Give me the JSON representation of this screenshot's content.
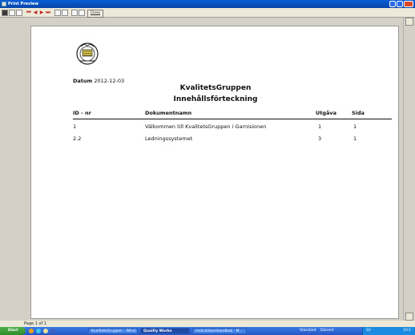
{
  "window": {
    "title": "Print Preview"
  },
  "toolbar": {
    "close_label": "Close"
  },
  "report": {
    "date_label": "Datum",
    "date_value": "2012-12-03",
    "company": "KvalitetsGruppen",
    "subtitle": "Innehållsförteckning",
    "columns": [
      "ID - nr",
      "Dokumentnamn",
      "Utgåva",
      "Sida"
    ],
    "rows": [
      [
        "1",
        "Välkommen till KvalitetsGruppen i Garnisionen",
        "1",
        "1"
      ],
      [
        "2.2",
        "Ledningssystemet",
        "3",
        "1"
      ]
    ]
  },
  "status": {
    "page": "Page 1 of 1"
  },
  "taskbar": {
    "start": "Start",
    "tasks": [
      "KvalitetsGruppen - Wind...",
      "Quality Works",
      "Instruktionshandbok - M..."
    ],
    "tray_items": [
      "Standard",
      "Danent",
      "SV",
      "10:1"
    ]
  }
}
